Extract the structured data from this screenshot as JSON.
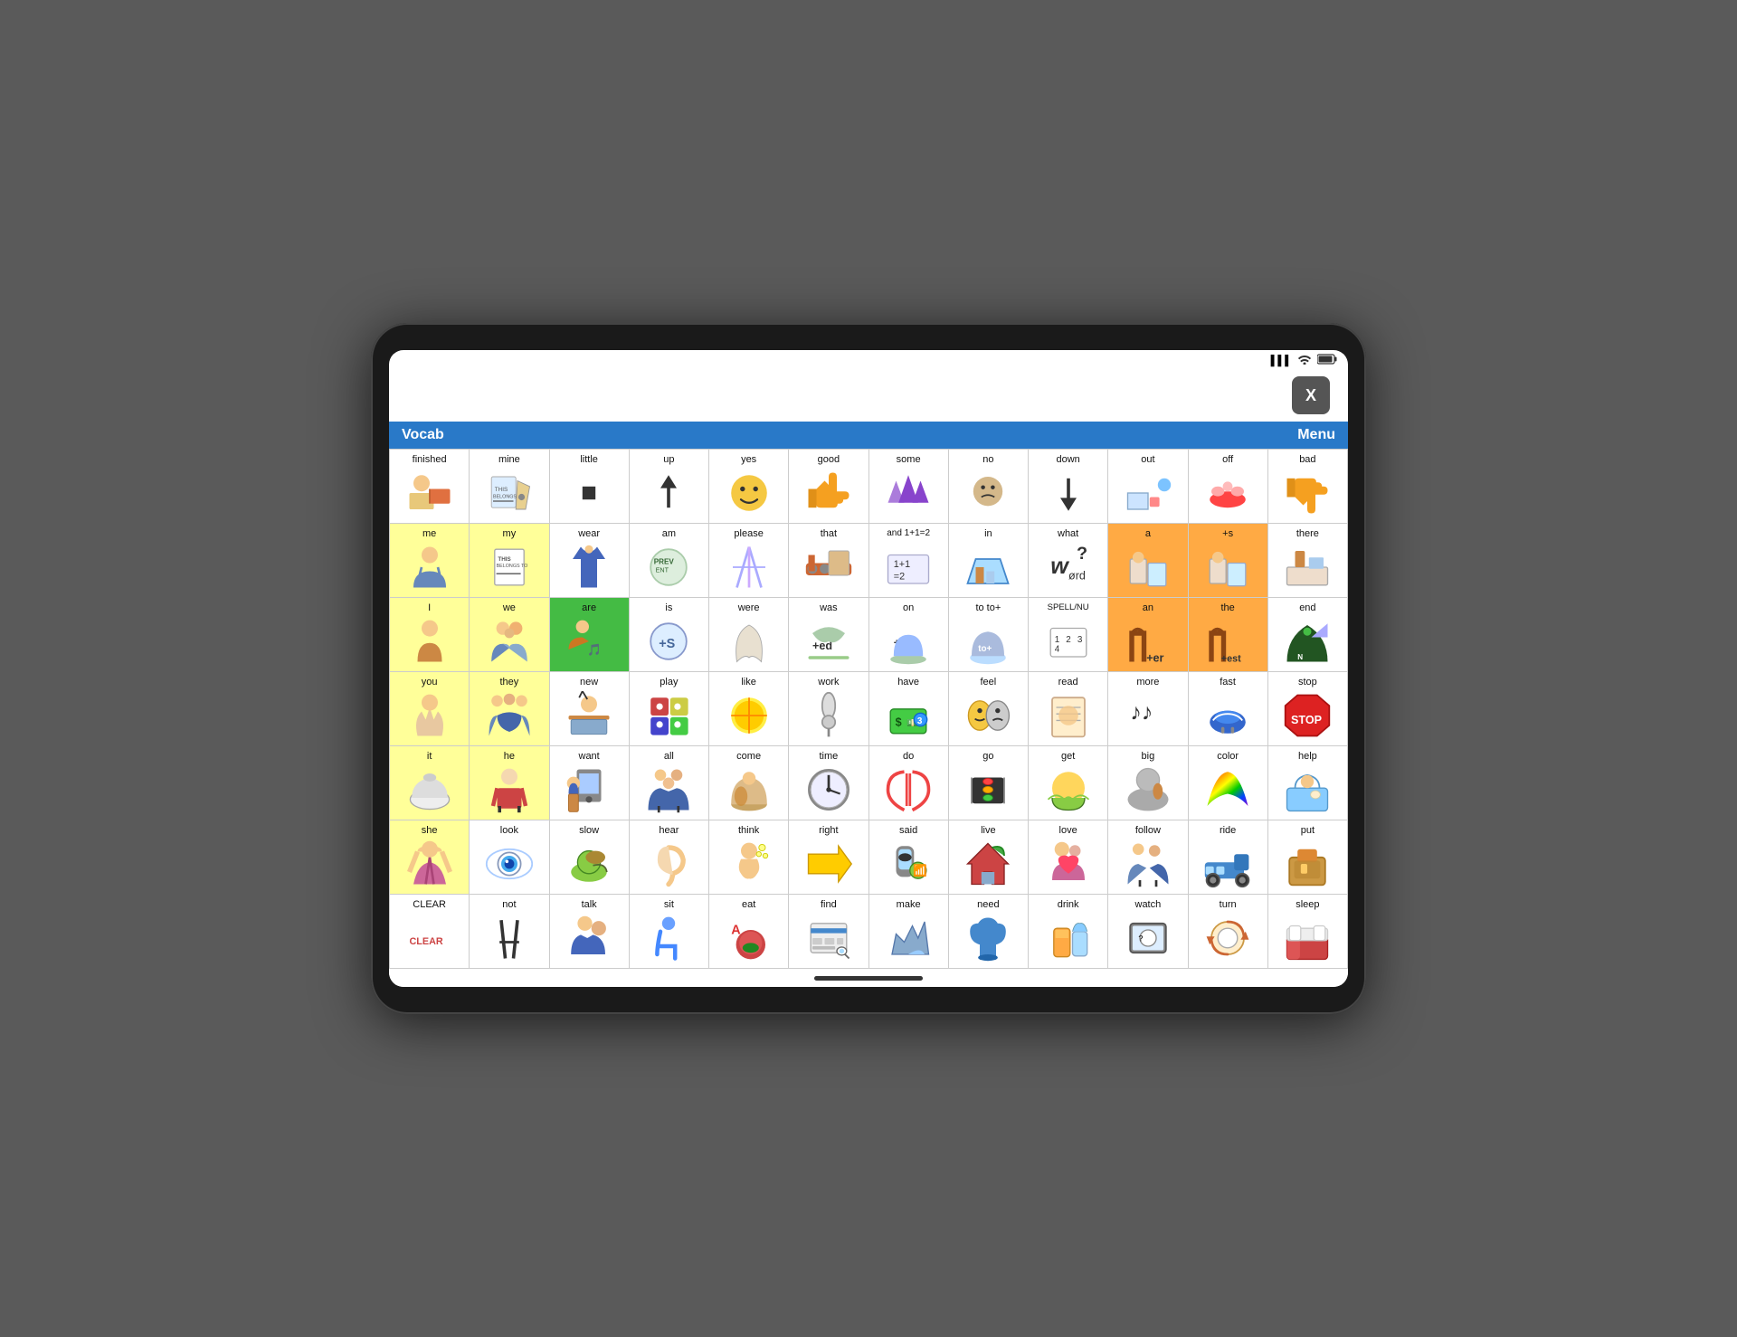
{
  "device": {
    "status_bar": {
      "signal": "▌▌▌",
      "wifi": "wifi",
      "battery": "🔋"
    },
    "x_button": "X",
    "home_indicator": true
  },
  "header": {
    "vocab_label": "Vocab",
    "menu_label": "Menu",
    "bg_color": "#2979c8"
  },
  "grid": {
    "rows": [
      [
        {
          "label": "finished",
          "icon": "🙋",
          "bg": "white"
        },
        {
          "label": "mine",
          "icon": "✏️",
          "bg": "white"
        },
        {
          "label": "little",
          "icon": "⬛",
          "bg": "white"
        },
        {
          "label": "up",
          "icon": "↑",
          "bg": "white"
        },
        {
          "label": "yes",
          "icon": "😊",
          "bg": "white"
        },
        {
          "label": "good",
          "icon": "👍",
          "bg": "white"
        },
        {
          "label": "some",
          "icon": "🔺",
          "bg": "white"
        },
        {
          "label": "no",
          "icon": "😒",
          "bg": "white"
        },
        {
          "label": "down",
          "icon": "↓",
          "bg": "white"
        },
        {
          "label": "out",
          "icon": "📦",
          "bg": "white"
        },
        {
          "label": "off",
          "icon": "💋",
          "bg": "white"
        },
        {
          "label": "bad",
          "icon": "👎",
          "bg": "white"
        }
      ],
      [
        {
          "label": "me",
          "icon": "👤",
          "bg": "yellow"
        },
        {
          "label": "my",
          "icon": "📋",
          "bg": "yellow"
        },
        {
          "label": "wear",
          "icon": "👔",
          "bg": "white"
        },
        {
          "label": "am",
          "icon": "🏅",
          "bg": "white"
        },
        {
          "label": "please",
          "icon": "✨",
          "bg": "white"
        },
        {
          "label": "that",
          "icon": "🚂",
          "bg": "white"
        },
        {
          "label": "and\n1+1=2",
          "icon": "🔢",
          "bg": "white"
        },
        {
          "label": "in",
          "icon": "🌉",
          "bg": "white"
        },
        {
          "label": "what\nwørd",
          "icon": "❓",
          "bg": "white"
        },
        {
          "label": "a",
          "icon": "🏠",
          "bg": "orange"
        },
        {
          "label": "+s",
          "icon": "🏠",
          "bg": "orange"
        },
        {
          "label": "there",
          "icon": "🛏️",
          "bg": "white"
        }
      ],
      [
        {
          "label": "I",
          "icon": "👩",
          "bg": "yellow"
        },
        {
          "label": "we",
          "icon": "👨‍👩‍👧",
          "bg": "yellow"
        },
        {
          "label": "are",
          "icon": "🎵",
          "bg": "green"
        },
        {
          "label": "is",
          "icon": "⚙️",
          "bg": "white"
        },
        {
          "label": "were",
          "icon": "👘",
          "bg": "white"
        },
        {
          "label": "was",
          "icon": "🌿",
          "bg": "white"
        },
        {
          "label": "on",
          "icon": "🪣",
          "bg": "white"
        },
        {
          "label": "to\nto+",
          "icon": "🪣",
          "bg": "white"
        },
        {
          "label": "SPELL/NU",
          "icon": "🔢",
          "bg": "white"
        },
        {
          "label": "an",
          "icon": "🖌️",
          "bg": "orange"
        },
        {
          "label": "the",
          "icon": "🖌️",
          "bg": "orange"
        },
        {
          "label": "end",
          "icon": "🌲",
          "bg": "white"
        }
      ],
      [
        {
          "label": "you",
          "icon": "👊",
          "bg": "yellow"
        },
        {
          "label": "they",
          "icon": "👨‍👩‍👧‍👦",
          "bg": "yellow"
        },
        {
          "label": "new",
          "icon": "🎓",
          "bg": "white"
        },
        {
          "label": "play",
          "icon": "🎲",
          "bg": "white"
        },
        {
          "label": "like",
          "icon": "☀️",
          "bg": "white"
        },
        {
          "label": "work",
          "icon": "🔧",
          "bg": "white"
        },
        {
          "label": "have",
          "icon": "💵",
          "bg": "white"
        },
        {
          "label": "feel",
          "icon": "🎭",
          "bg": "white"
        },
        {
          "label": "read",
          "icon": "📖",
          "bg": "white"
        },
        {
          "label": "more",
          "icon": "🎵",
          "bg": "white"
        },
        {
          "label": "fast",
          "icon": "👟",
          "bg": "white"
        },
        {
          "label": "stop",
          "icon": "🛑",
          "bg": "white"
        }
      ],
      [
        {
          "label": "it",
          "icon": "🐑",
          "bg": "yellow"
        },
        {
          "label": "he",
          "icon": "👦",
          "bg": "yellow"
        },
        {
          "label": "want",
          "icon": "🏢",
          "bg": "white"
        },
        {
          "label": "all",
          "icon": "👨‍👧‍👦",
          "bg": "white"
        },
        {
          "label": "come",
          "icon": "🐕",
          "bg": "white"
        },
        {
          "label": "time",
          "icon": "⏰",
          "bg": "white"
        },
        {
          "label": "do",
          "icon": "☝️",
          "bg": "white"
        },
        {
          "label": "go",
          "icon": "🚦",
          "bg": "white"
        },
        {
          "label": "get",
          "icon": "☀️",
          "bg": "white"
        },
        {
          "label": "big",
          "icon": "🐘",
          "bg": "white"
        },
        {
          "label": "color",
          "icon": "🌈",
          "bg": "white"
        },
        {
          "label": "help",
          "icon": "🛁",
          "bg": "white"
        }
      ],
      [
        {
          "label": "she",
          "icon": "👧",
          "bg": "yellow"
        },
        {
          "label": "look",
          "icon": "👁️",
          "bg": "white"
        },
        {
          "label": "slow",
          "icon": "🐌",
          "bg": "white"
        },
        {
          "label": "hear",
          "icon": "👂",
          "bg": "white"
        },
        {
          "label": "think",
          "icon": "🤔",
          "bg": "white"
        },
        {
          "label": "right",
          "icon": "➡️",
          "bg": "white"
        },
        {
          "label": "said",
          "icon": "📱",
          "bg": "white"
        },
        {
          "label": "live",
          "icon": "🏠",
          "bg": "white"
        },
        {
          "label": "love",
          "icon": "❤️",
          "bg": "white"
        },
        {
          "label": "follow",
          "icon": "🚶",
          "bg": "white"
        },
        {
          "label": "ride",
          "icon": "🚛",
          "bg": "white"
        },
        {
          "label": "put",
          "icon": "📦",
          "bg": "white"
        }
      ],
      [
        {
          "label": "CLEAR",
          "icon": "",
          "bg": "white"
        },
        {
          "label": "not",
          "icon": "✂️",
          "bg": "white"
        },
        {
          "label": "talk",
          "icon": "💬",
          "bg": "white"
        },
        {
          "label": "sit",
          "icon": "♿",
          "bg": "white"
        },
        {
          "label": "eat",
          "icon": "🍎",
          "bg": "white"
        },
        {
          "label": "find",
          "icon": "💻",
          "bg": "white"
        },
        {
          "label": "make",
          "icon": "✂️",
          "bg": "white"
        },
        {
          "label": "need",
          "icon": "☂️",
          "bg": "white"
        },
        {
          "label": "drink",
          "icon": "🥤",
          "bg": "white"
        },
        {
          "label": "watch",
          "icon": "📺",
          "bg": "white"
        },
        {
          "label": "turn",
          "icon": "🔄",
          "bg": "white"
        },
        {
          "label": "sleep",
          "icon": "🛏️",
          "bg": "white"
        }
      ]
    ]
  }
}
